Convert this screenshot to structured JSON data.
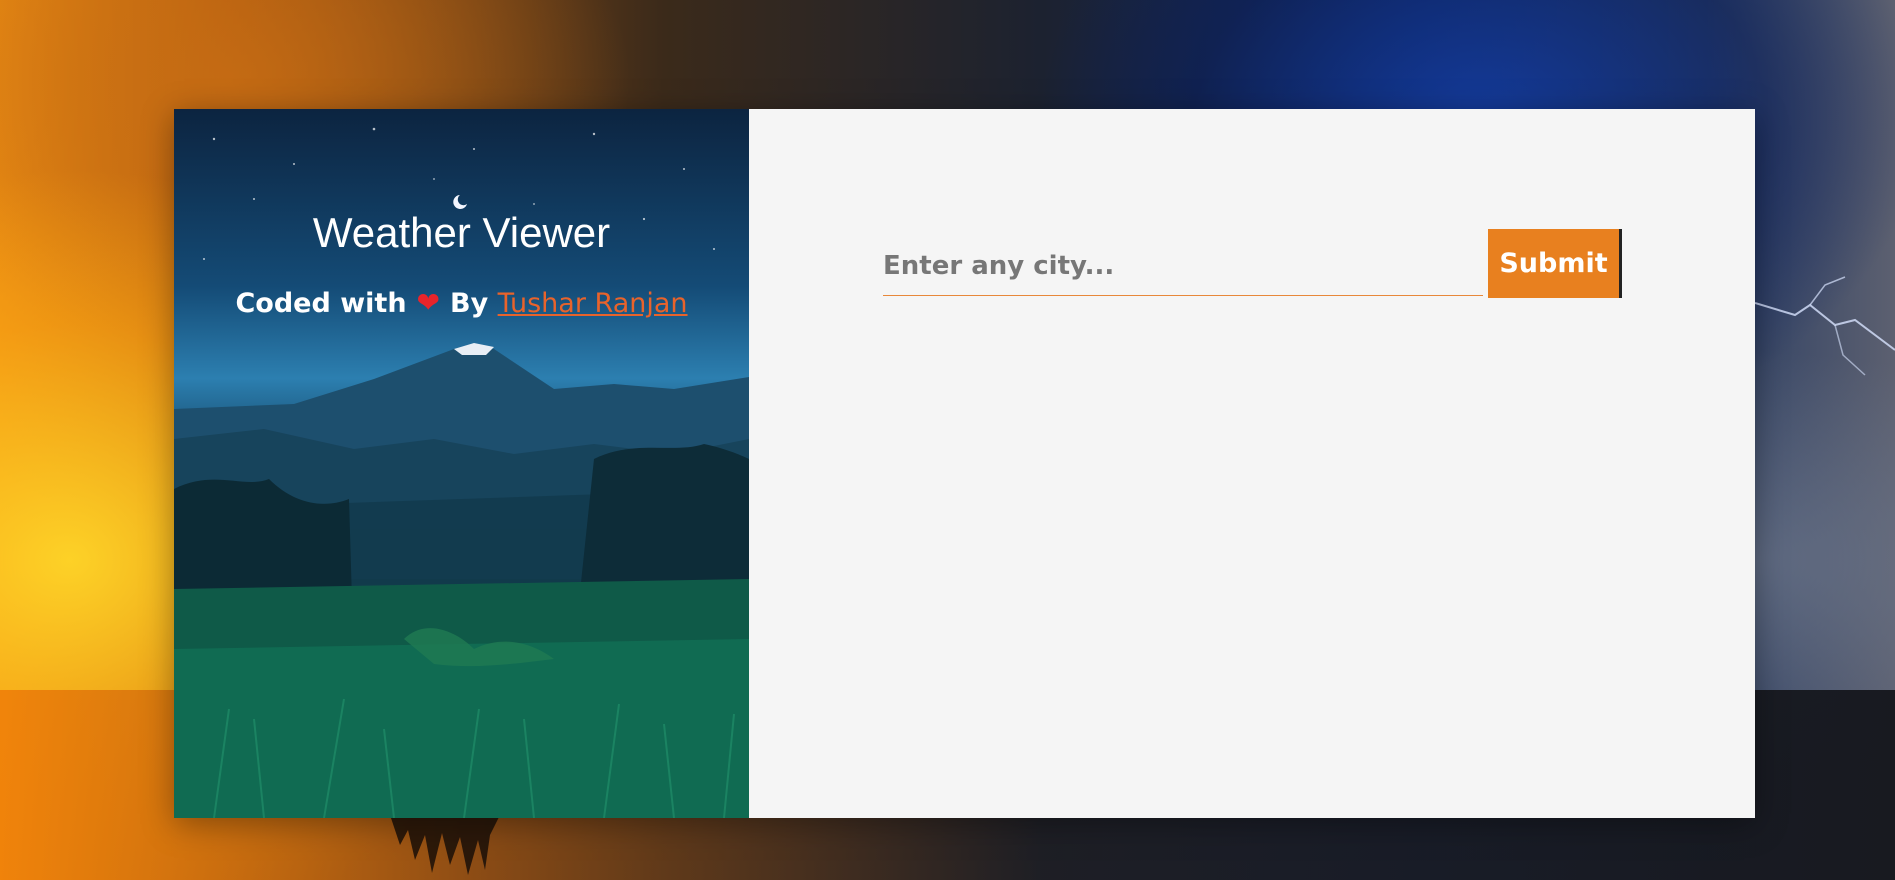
{
  "header": {
    "title": "Weather Viewer",
    "credit_prefix": "Coded with",
    "credit_by": "By",
    "author_link": "Tushar Ranjan"
  },
  "icons": {
    "heart": "heart-icon",
    "moon": "crescent-moon-icon",
    "lightning": "lightning-icon"
  },
  "search": {
    "placeholder": "Enter any city...",
    "value": "",
    "submit_label": "Submit"
  },
  "colors": {
    "accent": "#e8801f",
    "link": "#e8632b",
    "panel_background": "#f5f5f5",
    "heart": "#e8242b"
  }
}
